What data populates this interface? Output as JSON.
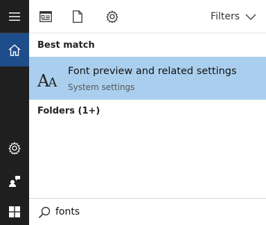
{
  "toolbar": {
    "filters_label": "Filters",
    "icons": [
      "apps-icon",
      "document-icon",
      "settings-gear-icon"
    ]
  },
  "rail": {
    "icons": [
      "hamburger-menu-icon",
      "home-icon",
      "settings-icon",
      "feedback-person-icon",
      "windows-start-icon"
    ]
  },
  "results": {
    "best_match_header": "Best match",
    "best_match": {
      "title": "Font preview and related settings",
      "subtitle": "System settings",
      "icon_glyph_big": "A",
      "icon_glyph_small": "A"
    },
    "folders_header": "Folders (1+)"
  },
  "search": {
    "value": "fonts"
  },
  "colors": {
    "rail_bg": "#1f1f1f",
    "active_rail": "#1e4d8b",
    "highlight": "#aacfee"
  }
}
